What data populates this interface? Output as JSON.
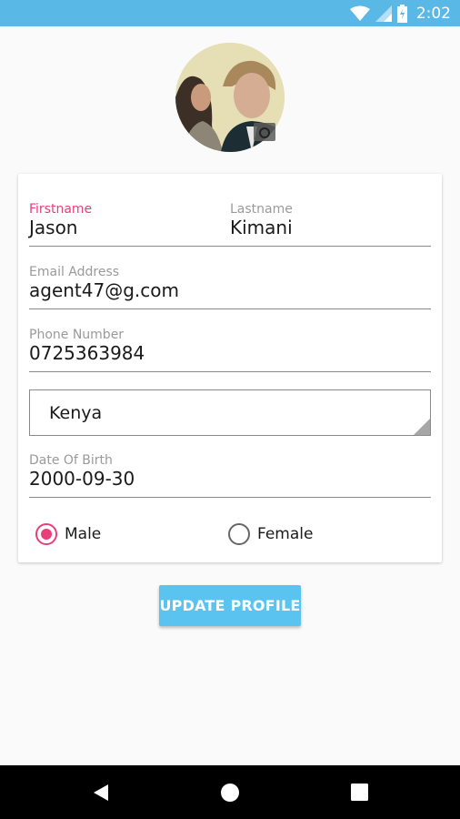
{
  "status_bar": {
    "time": "2:02",
    "icons": [
      "wifi-icon",
      "cell-signal-icon",
      "battery-icon"
    ]
  },
  "profile": {
    "avatar": "profile-photo",
    "camera_icon": "camera-icon"
  },
  "form": {
    "firstname": {
      "label": "Firstname",
      "value": "Jason"
    },
    "lastname": {
      "label": "Lastname",
      "value": "Kimani"
    },
    "email": {
      "label": "Email Address",
      "value": "agent47@g.com"
    },
    "phone": {
      "label": "Phone Number",
      "value": "0725363984"
    },
    "country": {
      "value": "Kenya"
    },
    "dob": {
      "label": "Date Of Birth",
      "value": "2000-09-30"
    },
    "gender": {
      "options": [
        {
          "label": "Male",
          "selected": true
        },
        {
          "label": "Female",
          "selected": false
        }
      ]
    }
  },
  "update_button": {
    "label": "UPDATE PROFILE"
  },
  "nav_bar": {
    "icons": [
      "back-icon",
      "home-icon",
      "recents-icon"
    ]
  },
  "colors": {
    "status_bar": "#5ab8e6",
    "accent": "#e83e7a",
    "button": "#5bc3ef"
  }
}
